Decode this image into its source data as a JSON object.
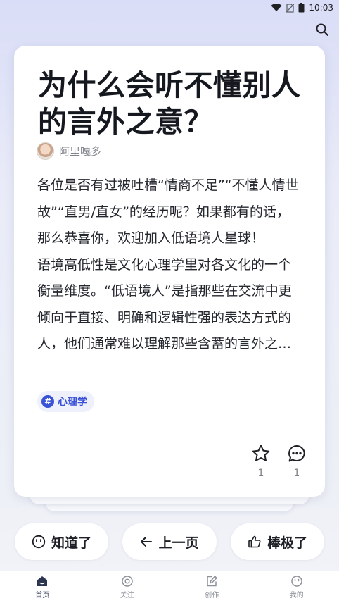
{
  "status_bar": {
    "time": "10:03"
  },
  "card": {
    "title": "为什么会听不懂别人的言外之意？",
    "author": "阿里嘎多",
    "body_p1": "各位是否有过被吐槽“情商不足”“不懂人情世故”“直男/直女”的经历呢？如果都有的话，那么恭喜你，欢迎加入低语境人星球！",
    "body_p2": "语境高低性是文化心理学里对各文化的一个衡量维度。“低语境人”是指那些在交流中更倾向于直接、明确和逻辑性强的表达方式的人，他们通常难以理解那些含蓄的言外之意。",
    "tag": "心理学",
    "star_count": "1",
    "comment_count": "1"
  },
  "buttons": {
    "know": "知道了",
    "prev": "上一页",
    "great": "棒极了"
  },
  "tabbar": {
    "home": "首页",
    "follow": "关注",
    "create": "创作",
    "mine": "我的"
  },
  "colors": {
    "accent": "#3a52d6",
    "background_top": "#d9ddf7",
    "text_primary": "#15181f"
  }
}
